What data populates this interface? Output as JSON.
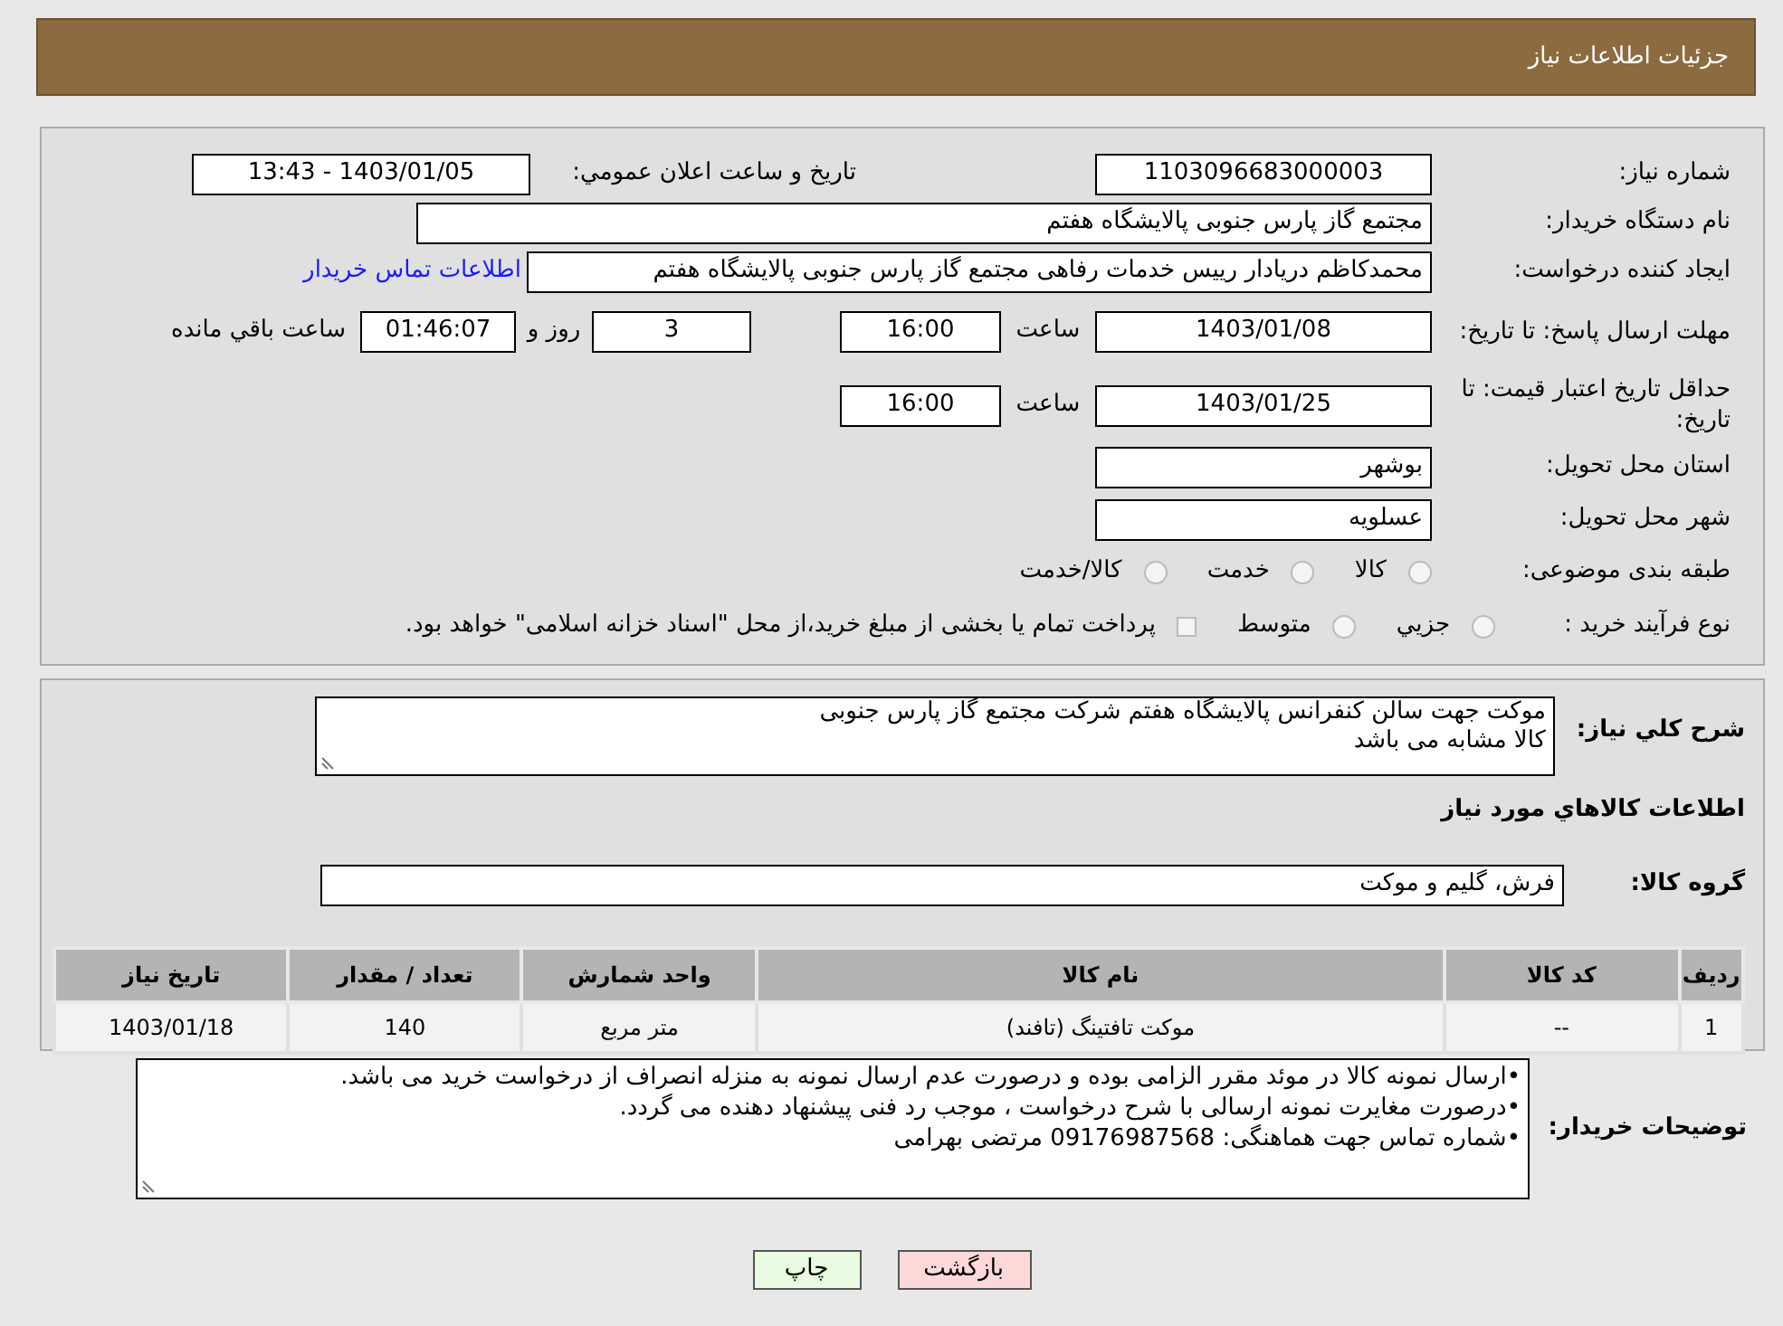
{
  "header": {
    "title": "جزئیات اطلاعات نیاز"
  },
  "need_number": {
    "label": "شماره نیاز:",
    "value": "1103096683000003"
  },
  "announce": {
    "label": "تاریخ و ساعت اعلان عمومي:",
    "value": "1403/01/05 - 13:43"
  },
  "buyer": {
    "label": "نام دستگاه خریدار:",
    "value": "مجتمع گاز پارس جنوبی  پالایشگاه هفتم"
  },
  "creator": {
    "label": "ایجاد کننده درخواست:",
    "value": "محمدکاظم دریادار رییس خدمات رفاهی مجتمع گاز پارس جنوبی  پالایشگاه هفتم",
    "link": "اطلاعات تماس خریدار"
  },
  "deadline": {
    "label": "مهلت ارسال پاسخ: تا تاریخ:",
    "date": "1403/01/08",
    "time_label": "ساعت",
    "time": "16:00",
    "days": "3",
    "days_label": "روز و",
    "remaining": "01:46:07",
    "remaining_label": "ساعت باقي مانده"
  },
  "validity": {
    "label": "حداقل تاریخ اعتبار قیمت: تا تاریخ:",
    "date": "1403/01/25",
    "time_label": "ساعت",
    "time": "16:00"
  },
  "province": {
    "label": "استان محل تحویل:",
    "value": "بوشهر"
  },
  "city": {
    "label": "شهر محل تحویل:",
    "value": "عسلویه"
  },
  "category": {
    "label": "طبقه بندی موضوعی:",
    "options": [
      {
        "label": "کالا",
        "selected": false
      },
      {
        "label": "خدمت",
        "selected": false
      },
      {
        "label": "کالا/خدمت",
        "selected": false
      }
    ]
  },
  "process": {
    "label": "نوع فرآیند خرید :",
    "options": [
      {
        "kind": "radio",
        "label": "جزيي",
        "selected": false
      },
      {
        "kind": "radio",
        "label": "متوسط",
        "selected": false
      },
      {
        "kind": "checkbox",
        "label": "پرداخت تمام یا بخشی از مبلغ خرید،از محل \"اسناد خزانه اسلامی\" خواهد بود.",
        "checked": false
      }
    ]
  },
  "description": {
    "label": "شرح کلي نیاز:",
    "lines": [
      "موکت جهت سالن کنفرانس پالایشگاه هفتم شرکت مجتمع گاز پارس جنوبی",
      "کالا مشابه می باشد"
    ]
  },
  "goods_heading": "اطلاعات کالاهاي مورد نیاز",
  "goods_group": {
    "label": "گروه کالا:",
    "value": "فرش، گلیم و موکت"
  },
  "table": {
    "columns": [
      "ردیف",
      "کد کالا",
      "نام کالا",
      "واحد شمارش",
      "تعداد / مقدار",
      "تاریخ نیاز"
    ],
    "rows": [
      [
        "1",
        "--",
        "موکت تافتینگ (تافند)",
        "متر مربع",
        "140",
        "1403/01/18"
      ]
    ]
  },
  "notes": {
    "label": "توضیحات خریدار:",
    "lines": [
      "•ارسال نمونه کالا در موئد مقرر الزامی بوده و درصورت عدم ارسال نمونه به منزله انصراف از درخواست خرید می باشد.",
      "•درصورت مغایرت نمونه ارسالی با شرح درخواست ، موجب رد فنی پیشنهاد دهنده می گردد.",
      "•شماره تماس جهت هماهنگی: 09176987568 مرتضی بهرامی"
    ]
  },
  "buttons": [
    {
      "kind": "back",
      "label": "بازگشت"
    },
    {
      "kind": "print",
      "label": "چاپ"
    }
  ]
}
